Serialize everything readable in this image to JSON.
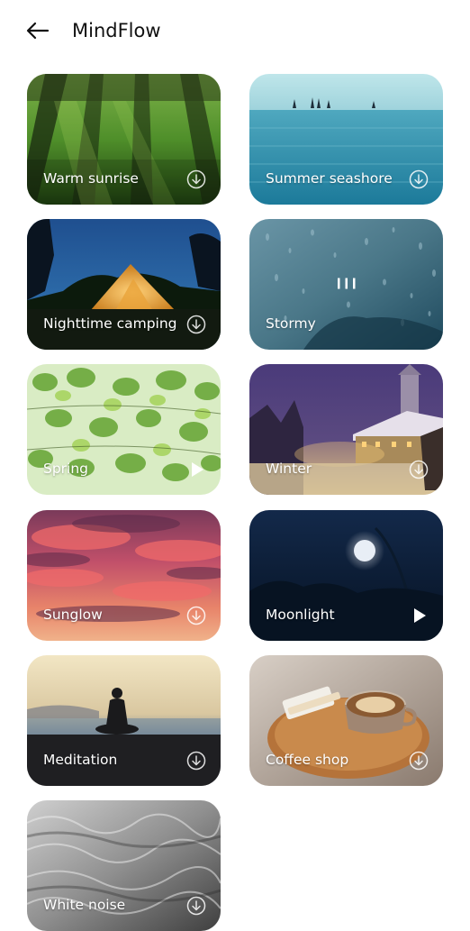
{
  "header": {
    "back_icon": "arrow-left-icon",
    "title": "MindFlow"
  },
  "cards": [
    {
      "label": "Warm sunrise",
      "action": "download",
      "scene": "forest"
    },
    {
      "label": "Summer seashore",
      "action": "download",
      "scene": "sea"
    },
    {
      "label": "Nighttime camping",
      "action": "download",
      "scene": "tent"
    },
    {
      "label": "Stormy",
      "action": "download",
      "scene": "rain",
      "state": "playing"
    },
    {
      "label": "Spring",
      "action": "play",
      "scene": "leaves"
    },
    {
      "label": "Winter",
      "action": "download",
      "scene": "village"
    },
    {
      "label": "Sunglow",
      "action": "download",
      "scene": "sunset"
    },
    {
      "label": "Moonlight",
      "action": "play",
      "scene": "moon"
    },
    {
      "label": "Meditation",
      "action": "download",
      "scene": "meditation"
    },
    {
      "label": "Coffee shop",
      "action": "download",
      "scene": "coffee"
    },
    {
      "label": "White noise",
      "action": "download",
      "scene": "noise"
    }
  ],
  "icons": {
    "download": "download-circle-icon",
    "play": "play-icon",
    "playing": "pause-bars-icon"
  },
  "colors": {
    "background": "#ffffff",
    "title": "#111111",
    "card_text": "#ffffff"
  }
}
